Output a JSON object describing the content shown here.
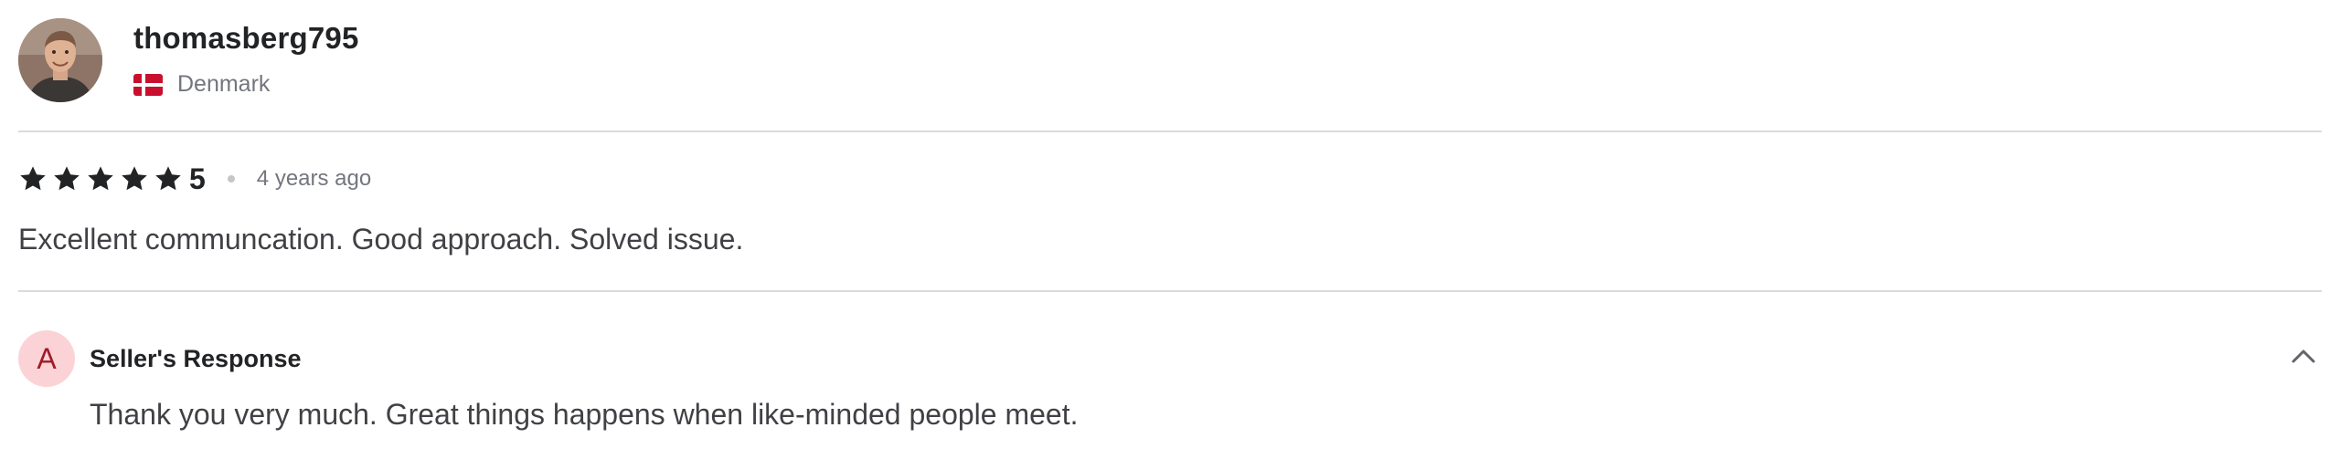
{
  "reviewer": {
    "username": "thomasberg795",
    "country": "Denmark",
    "flag_icon": "denmark-flag-icon"
  },
  "rating": {
    "stars": 5,
    "value": "5",
    "time_ago": "4 years ago",
    "star_color": "#222325"
  },
  "review": {
    "text": "Excellent communcation. Good approach. Solved issue."
  },
  "seller_response": {
    "avatar_letter": "A",
    "title": "Seller's Response",
    "text": "Thank you very much. Great things happens when like-minded people meet.",
    "toggle_icon": "chevron-up-icon",
    "avatar_bg": "#fbd3d6",
    "avatar_fg": "#9e1c28"
  }
}
